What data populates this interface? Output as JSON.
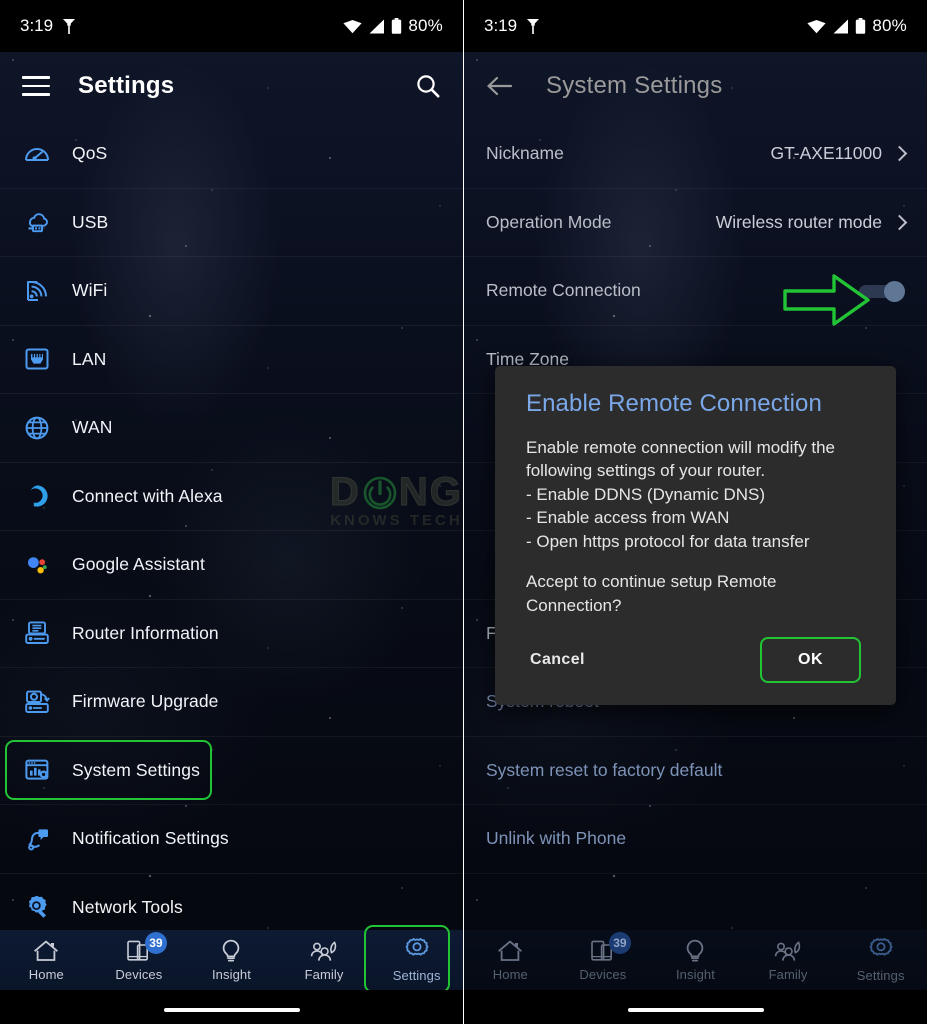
{
  "status_bar": {
    "time": "3:19",
    "battery_text": "80%",
    "icons": [
      "wifi-icon",
      "cellular-signal-icon",
      "battery-icon"
    ],
    "carrier_icon": "vpn-key-icon"
  },
  "left_panel": {
    "appbar": {
      "menu_icon": "hamburger-menu-icon",
      "title": "Settings",
      "search_icon": "search-icon"
    },
    "menu_items": [
      {
        "label": "QoS",
        "icon": "speedometer-icon",
        "highlighted": false
      },
      {
        "label": "USB",
        "icon": "cloud-usb-icon",
        "highlighted": false
      },
      {
        "label": "WiFi",
        "icon": "wifi-signal-icon",
        "highlighted": false
      },
      {
        "label": "LAN",
        "icon": "ethernet-port-icon",
        "highlighted": false
      },
      {
        "label": "WAN",
        "icon": "globe-icon",
        "highlighted": false
      },
      {
        "label": "Connect with Alexa",
        "icon": "alexa-icon",
        "highlighted": false
      },
      {
        "label": "Google Assistant",
        "icon": "google-assistant-icon",
        "highlighted": false
      },
      {
        "label": "Router Information",
        "icon": "router-info-icon",
        "highlighted": false
      },
      {
        "label": "Firmware Upgrade",
        "icon": "firmware-upgrade-icon",
        "highlighted": false
      },
      {
        "label": "System Settings",
        "icon": "system-settings-icon",
        "highlighted": true
      },
      {
        "label": "Notification Settings",
        "icon": "notification-bell-icon",
        "highlighted": false
      },
      {
        "label": "Network Tools",
        "icon": "network-tools-icon",
        "highlighted": false
      }
    ]
  },
  "right_panel": {
    "appbar": {
      "back_icon": "back-arrow-icon",
      "title": "System Settings"
    },
    "rows": [
      {
        "label": "Nickname",
        "value": "GT-AXE11000",
        "control": "chevron"
      },
      {
        "label": "Operation Mode",
        "value": "Wireless router mode",
        "control": "chevron"
      },
      {
        "label": "Remote Connection",
        "value": "",
        "control": "toggle",
        "toggle_on": true
      },
      {
        "label": "Time Zone",
        "value": "",
        "control": "chevron"
      },
      {
        "label": "Feedback",
        "value": "",
        "control": "none"
      },
      {
        "label": "System reboot",
        "value": "",
        "control": "none",
        "style": "blue"
      },
      {
        "label": "System reset to factory default",
        "value": "",
        "control": "none",
        "style": "blue"
      },
      {
        "label": "Unlink with Phone",
        "value": "",
        "control": "none",
        "style": "blue"
      }
    ]
  },
  "dialog": {
    "title": "Enable Remote Connection",
    "line1": "Enable remote connection will modify the",
    "line2": "following settings of your router.",
    "bullet1": "- Enable DDNS (Dynamic DNS)",
    "bullet2": "- Enable access from WAN",
    "bullet3": "- Open https protocol for data transfer",
    "question1": "Accept to continue setup Remote",
    "question2": "Connection?",
    "cancel_label": "Cancel",
    "ok_label": "OK"
  },
  "bottom_nav": {
    "items": [
      {
        "label": "Home",
        "icon": "home-icon",
        "badge": ""
      },
      {
        "label": "Devices",
        "icon": "devices-icon",
        "badge": "39"
      },
      {
        "label": "Insight",
        "icon": "lightbulb-icon",
        "badge": ""
      },
      {
        "label": "Family",
        "icon": "family-group-icon",
        "badge": ""
      },
      {
        "label": "Settings",
        "icon": "gear-icon",
        "badge": ""
      }
    ],
    "active_index": 4
  },
  "watermark": {
    "text_before": "D",
    "text_after": "NG",
    "subtitle": "KNOWS TECH",
    "power_icon": "power-button-icon"
  },
  "colors": {
    "accent_green": "#22c436",
    "dialog_title_blue": "#7aa7e8",
    "icon_blue": "#4d9bf0",
    "badge_blue": "#2f6fd0"
  }
}
